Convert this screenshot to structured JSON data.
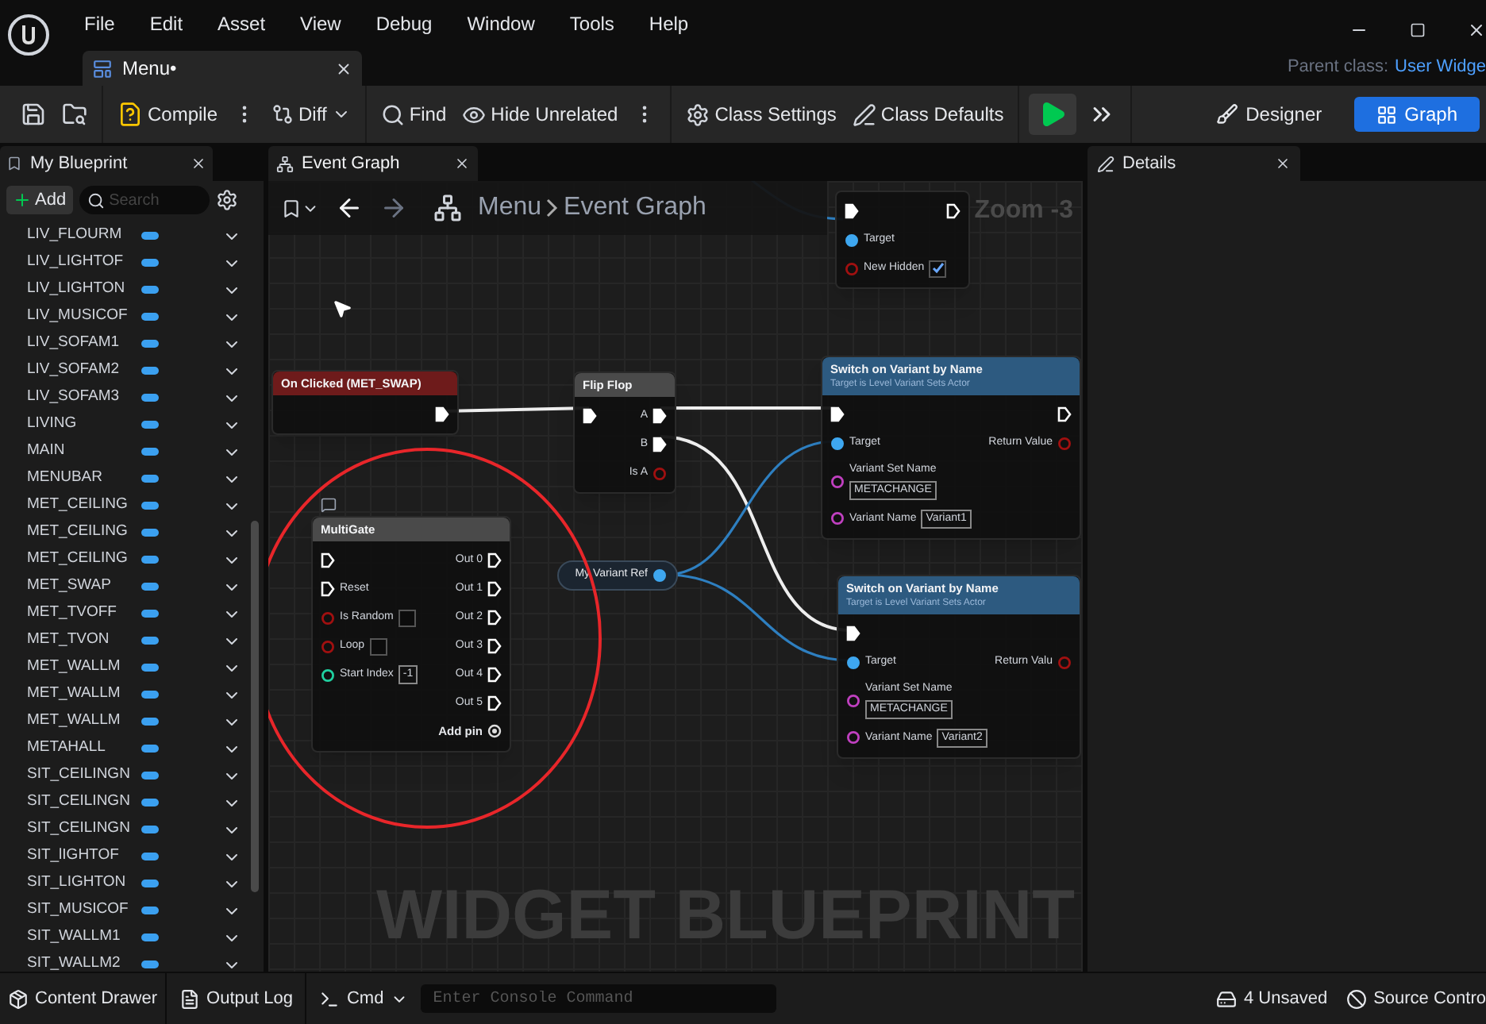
{
  "menu": [
    "File",
    "Edit",
    "Asset",
    "View",
    "Debug",
    "Window",
    "Tools",
    "Help"
  ],
  "document_tab": {
    "label": "Menu•",
    "selected": true
  },
  "parent_class": {
    "label": "Parent class:",
    "value": "User Widge"
  },
  "toolbar": [
    [
      {
        "kind": "save"
      },
      {
        "kind": "browse"
      }
    ],
    [
      {
        "kind": "compile",
        "label": "Compile"
      },
      {
        "kind": "more"
      },
      {
        "kind": "diff",
        "label": "Diff"
      }
    ],
    [
      {
        "kind": "find",
        "label": "Find"
      },
      {
        "kind": "hide",
        "label": "Hide Unrelated"
      },
      {
        "kind": "more"
      }
    ],
    [
      {
        "kind": "settings",
        "label": "Class Settings"
      },
      {
        "kind": "defaults",
        "label": "Class Defaults"
      }
    ],
    [
      {
        "kind": "play"
      },
      {
        "kind": "expand"
      }
    ]
  ],
  "modes": [
    {
      "label": "Designer",
      "selected": false
    },
    {
      "label": "Graph",
      "selected": true
    }
  ],
  "my_blueprint": {
    "tab": "My Blueprint",
    "add_button": "Add",
    "search": {
      "placeholder": "Search"
    },
    "items": [
      "LIV_FLOURM",
      "LIV_LIGHTOF",
      "LIV_LIGHTON",
      "LIV_MUSICOF",
      "LIV_SOFAM1",
      "LIV_SOFAM2",
      "LIV_SOFAM3",
      "LIVING",
      "MAIN",
      "MENUBAR",
      "MET_CEILING",
      "MET_CEILING",
      "MET_CEILING",
      "MET_SWAP",
      "MET_TVOFF",
      "MET_TVON",
      "MET_WALLM",
      "MET_WALLM",
      "MET_WALLM",
      "METAHALL",
      "SIT_CEILINGN",
      "SIT_CEILINGN",
      "SIT_CEILINGN",
      "SIT_lIGHTOF",
      "SIT_LIGHTON",
      "SIT_MUSICOF",
      "SIT_WALLM1",
      "SIT_WALLM2"
    ]
  },
  "graph_tab": "Event Graph",
  "breadcrumb": [
    "Menu",
    "Event Graph"
  ],
  "zoom": "Zoom -3",
  "nodes": [
    {
      "kind": "function",
      "rows": [
        {
          "in": {
            "kind": "exec",
            "linked": true
          },
          "out": {
            "kind": "exec",
            "linked": false
          }
        },
        {
          "in": {
            "kind": "object",
            "label": "Target",
            "linked": true
          }
        },
        {
          "in": {
            "kind": "bool",
            "label": "New Hidden",
            "checked": true,
            "linked": false
          }
        }
      ]
    },
    {
      "kind": "event",
      "title": "On Clicked (MET_SWAP)",
      "rows": [
        {
          "out": {
            "kind": "exec",
            "linked": true
          }
        }
      ]
    },
    {
      "kind": "macro",
      "title": "Flip Flop",
      "rows": [
        {
          "in": {
            "kind": "exec",
            "linked": true
          },
          "out": {
            "kind": "exec",
            "label": "A",
            "linked": true
          }
        },
        {
          "out": {
            "kind": "exec",
            "label": "B",
            "linked": true
          }
        },
        {
          "out": {
            "kind": "bool",
            "label": "Is A",
            "linked": false
          }
        }
      ]
    },
    {
      "kind": "function",
      "title": "Switch on Variant by Name",
      "subtitle": "Target is Level Variant Sets Actor",
      "rows": [
        {
          "in": {
            "kind": "exec",
            "linked": true
          },
          "out": {
            "kind": "exec",
            "linked": false
          }
        },
        {
          "in": {
            "kind": "object",
            "label": "Target",
            "linked": true
          },
          "out": {
            "kind": "bool",
            "label": "Return Value",
            "linked": false
          }
        },
        {
          "in": {
            "kind": "name",
            "label": "Variant Set Name",
            "value": "METACHANGE",
            "wrap": true,
            "linked": false
          }
        },
        {
          "in": {
            "kind": "name",
            "label": "Variant Name",
            "value": "Variant1",
            "linked": false
          }
        }
      ]
    },
    {
      "kind": "macro",
      "title": "MultiGate",
      "comment": true,
      "footer": "Add pin",
      "rows": [
        {
          "in": {
            "kind": "exec",
            "linked": false
          },
          "out": {
            "kind": "exec",
            "label": "Out 0",
            "linked": false
          }
        },
        {
          "in": {
            "kind": "exec",
            "label": "Reset",
            "linked": false
          },
          "out": {
            "kind": "exec",
            "label": "Out 1",
            "linked": false
          }
        },
        {
          "in": {
            "kind": "bool",
            "label": "Is Random",
            "checked": false,
            "linked": false
          },
          "out": {
            "kind": "exec",
            "label": "Out 2",
            "linked": false
          }
        },
        {
          "in": {
            "kind": "bool",
            "label": "Loop",
            "checked": false,
            "linked": false
          },
          "out": {
            "kind": "exec",
            "label": "Out 3",
            "linked": false
          }
        },
        {
          "in": {
            "kind": "int",
            "label": "Start Index",
            "value": "-1",
            "linked": false
          },
          "out": {
            "kind": "exec",
            "label": "Out 4",
            "linked": false
          }
        },
        {
          "out": {
            "kind": "exec",
            "label": "Out 5",
            "linked": false
          }
        }
      ]
    },
    {
      "kind": "variable",
      "title": "My Variant Ref",
      "rows": [
        {
          "out": {
            "kind": "object",
            "linked": true
          }
        }
      ]
    },
    {
      "kind": "function",
      "title": "Switch on Variant by Name",
      "subtitle": "Target is Level Variant Sets Actor",
      "rows": [
        {
          "in": {
            "kind": "exec",
            "linked": true
          }
        },
        {
          "in": {
            "kind": "object",
            "label": "Target",
            "linked": true
          },
          "out": {
            "kind": "bool",
            "label": "Return Valu",
            "linked": false
          }
        },
        {
          "in": {
            "kind": "name",
            "label": "Variant Set Name",
            "value": "METACHANGE",
            "wrap": true,
            "linked": false
          }
        },
        {
          "in": {
            "kind": "name",
            "label": "Variant Name",
            "value": "Variant2",
            "linked": false
          }
        }
      ]
    }
  ],
  "graph_label": "WIDGET BLUEPRINT",
  "details_tab": "Details",
  "status_bar": {
    "content_drawer": "Content Drawer",
    "output_log": "Output Log",
    "cmd": "Cmd",
    "console": {
      "placeholder": "Enter Console Command"
    },
    "unsaved": "4 Unsaved",
    "source_control": "Source Contro"
  }
}
